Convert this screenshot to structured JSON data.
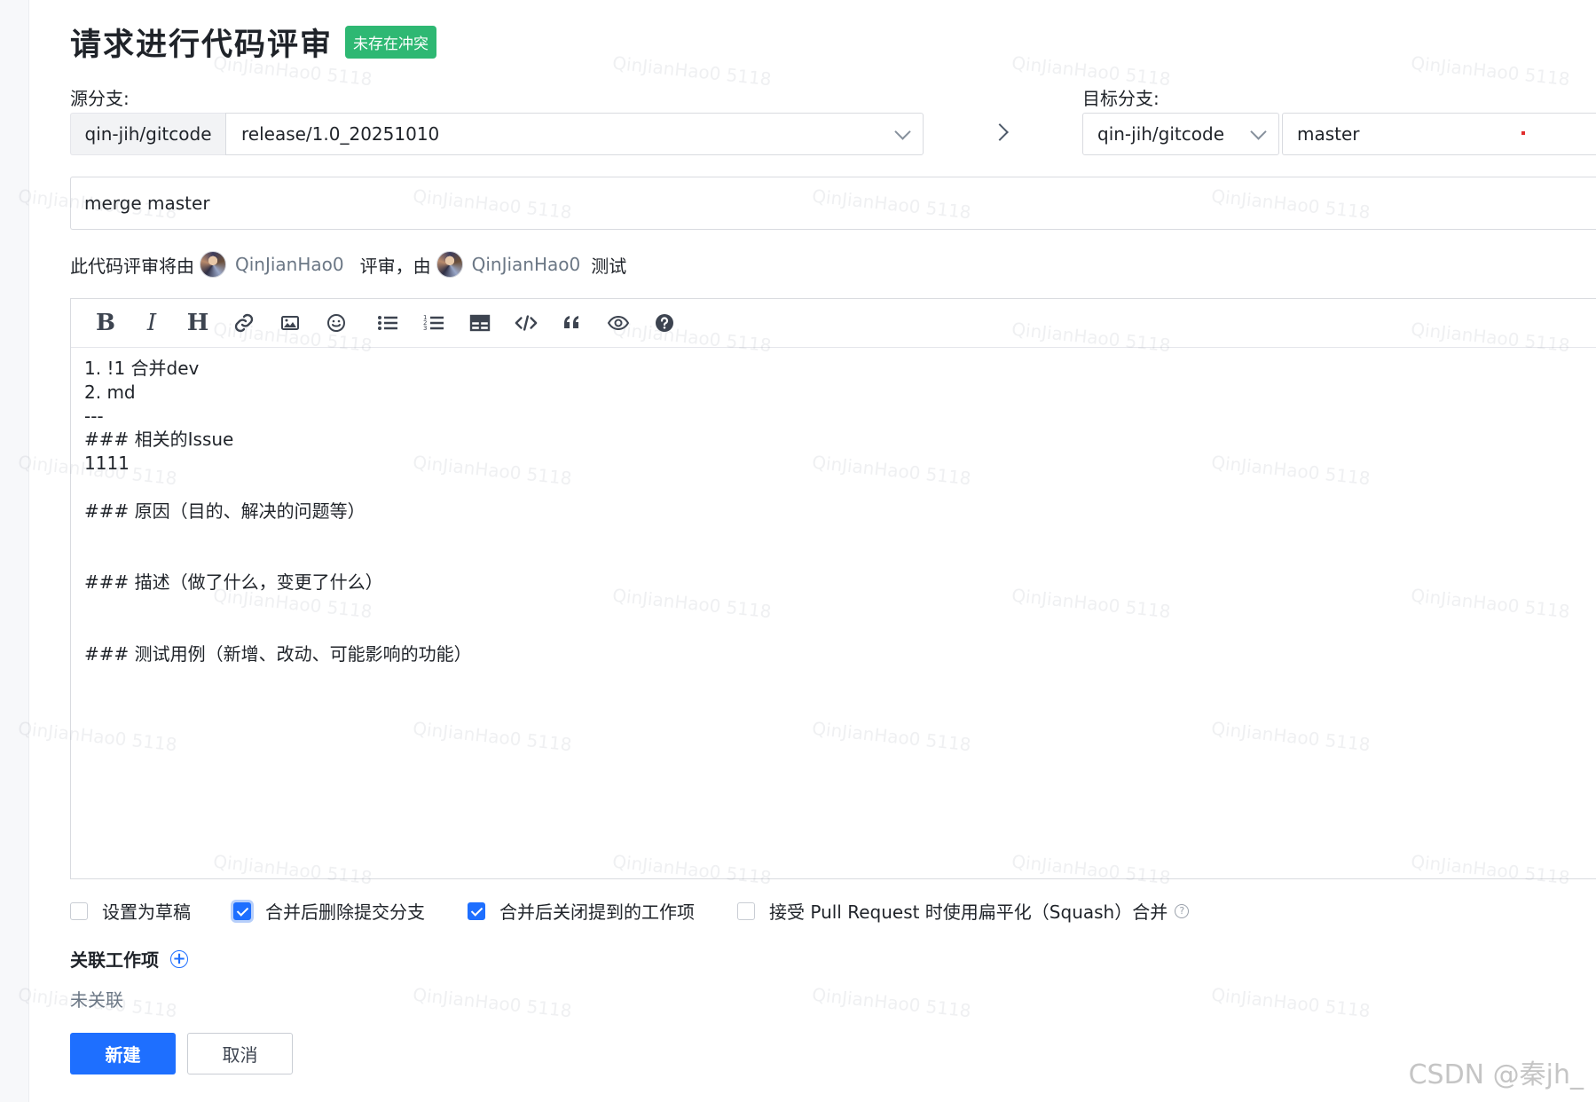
{
  "header": {
    "title": "请求进行代码评审",
    "badge": "未存在冲突"
  },
  "source": {
    "label": "源分支:",
    "repo": "qin-jih/gitcode",
    "branch": "release/1.0_20251010"
  },
  "target": {
    "label": "目标分支:",
    "repo": "qin-jih/gitcode",
    "branch": "master"
  },
  "title_input": {
    "value": "merge master"
  },
  "reviewers": {
    "prefix": "此代码评审将由",
    "reviewer": "QinJianHao0",
    "middle": "评审，由",
    "tester": "QinJianHao0",
    "suffix": "测试"
  },
  "editor": {
    "content": "1. !1 合并dev\n2. md\n---\n### 相关的Issue\n1111\n\n### 原因（目的、解决的问题等）\n\n\n### 描述（做了什么，变更了什么）\n\n\n### 测试用例（新增、改动、可能影响的功能）"
  },
  "options": [
    {
      "label": "设置为草稿",
      "checked": false
    },
    {
      "label": "合并后删除提交分支",
      "checked": true
    },
    {
      "label": "合并后关闭提到的工作项",
      "checked": true
    },
    {
      "label": "接受 Pull Request 时使用扁平化（Squash）合并",
      "checked": false
    }
  ],
  "related": {
    "title": "关联工作项",
    "empty_text": "未关联"
  },
  "buttons": {
    "create": "新建",
    "cancel": "取消"
  },
  "watermark": {
    "text": "QinJianHao0 5118",
    "site_mark": "CSDN @秦jh_"
  },
  "colors": {
    "primary": "#1e6fff",
    "badge": "#2eb873"
  }
}
